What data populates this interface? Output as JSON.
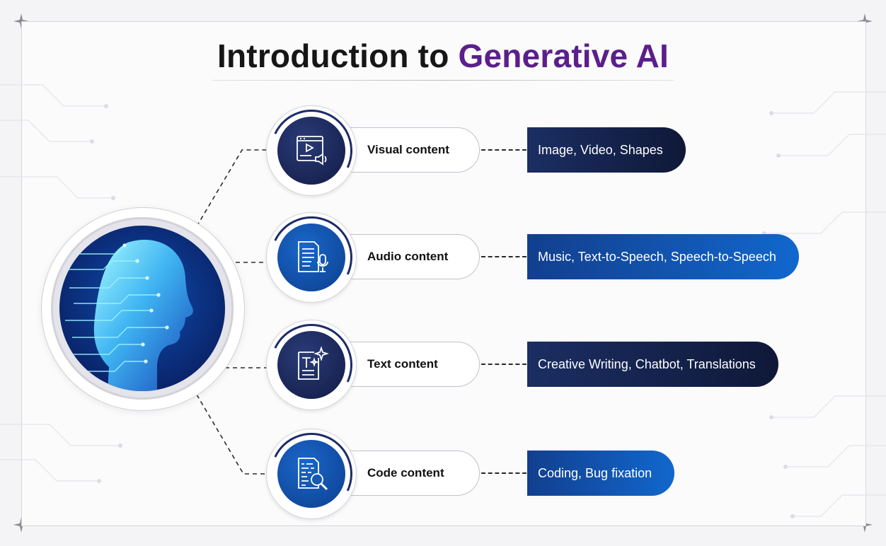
{
  "title": {
    "lead": "Introduction to",
    "accent": "Generative AI"
  },
  "hub": {
    "icon": "ai-head-circuit-icon"
  },
  "categories": [
    {
      "label": "Visual content",
      "details": "Image, Video, Shapes",
      "icon": "video-player-speaker-icon"
    },
    {
      "label": "Audio content",
      "details": "Music, Text-to-Speech, Speech-to-Speech",
      "icon": "document-microphone-icon"
    },
    {
      "label": "Text content",
      "details": "Creative Writing, Chatbot, Translations",
      "icon": "document-text-sparkle-icon"
    },
    {
      "label": "Code content",
      "details": "Coding, Bug fixation",
      "icon": "document-magnifier-icon"
    }
  ],
  "colors": {
    "title_accent": "#5b1f8c",
    "navy": "#111b45",
    "blue": "#1167cd",
    "head_glow": "#8ff3ff"
  }
}
